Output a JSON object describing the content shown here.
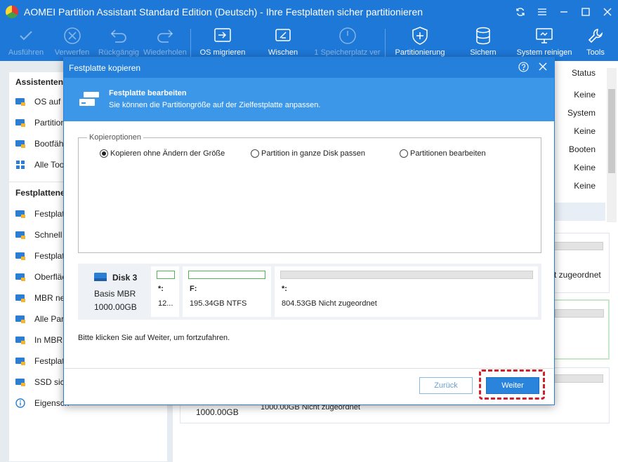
{
  "window": {
    "title": "AOMEI Partition Assistant Standard Edition (Deutsch) - Ihre Festplatten sicher partitionieren"
  },
  "toolbar": {
    "apply": "Ausführen",
    "discard": "Verwerfen",
    "undo": "Rückgängig",
    "redo": "Wiederholen",
    "migrate_os": "OS migrieren",
    "wipe": "Wischen",
    "free_space": "1 Speicherplatz ver",
    "partition": "Partitionierung",
    "backup": "Sichern",
    "clean": "System reinigen",
    "tools": "Tools"
  },
  "sidebar": {
    "wizards_heading": "Assistenten",
    "wizards": [
      {
        "label": "OS auf S",
        "icon": "os-migrate-icon"
      },
      {
        "label": "Partition",
        "icon": "partition-icon"
      },
      {
        "label": "Bootfähi",
        "icon": "bootable-icon"
      },
      {
        "label": "Alle Tool",
        "icon": "all-tools-icon"
      }
    ],
    "disk_heading": "Festplattene",
    "disk_ops": [
      {
        "label": "Festplatt",
        "icon": "disk-copy-icon"
      },
      {
        "label": "Schnell p",
        "icon": "quick-partition-icon"
      },
      {
        "label": "Festplatt",
        "icon": "disk-wipe-icon"
      },
      {
        "label": "Oberfläc",
        "icon": "surface-test-icon"
      },
      {
        "label": "MBR neu",
        "icon": "mbr-icon"
      },
      {
        "label": "Alle Part",
        "icon": "delete-all-icon"
      },
      {
        "label": "In MBR k",
        "icon": "convert-mbr-icon"
      },
      {
        "label": "Festplatt",
        "icon": "disk-properties-icon"
      },
      {
        "label": "SSD sich",
        "icon": "ssd-erase-icon"
      },
      {
        "label": "Eigensch",
        "icon": "info-icon"
      }
    ]
  },
  "table": {
    "status_header": "Status",
    "status_values": [
      "Keine",
      "System",
      "Keine",
      "Booten",
      "Keine",
      "Keine"
    ]
  },
  "background": {
    "disk_text_right": "t zugeordnet",
    "disk_size": "1000.00GB",
    "disk_part_text": "1000.00GB Nicht zugeordnet"
  },
  "dialog": {
    "title": "Festplatte kopieren",
    "header_title": "Festplatte bearbeiten",
    "header_subtitle": "Sie können die Partitiongröße auf der Zielfestplatte anpassen.",
    "options_legend": "Kopieroptionen",
    "options": [
      {
        "label": "Kopieren ohne Ändern der Größe",
        "selected": true
      },
      {
        "label": "Partition in ganze Disk passen",
        "selected": false
      },
      {
        "label": "Partitionen bearbeiten",
        "selected": false
      }
    ],
    "disk": {
      "name": "Disk 3",
      "type": "Basis MBR",
      "size": "1000.00GB",
      "partitions": [
        {
          "letter": "*:",
          "info": "12..."
        },
        {
          "letter": "F:",
          "info": "195.34GB NTFS"
        },
        {
          "letter": "*:",
          "info": "804.53GB Nicht zugeordnet"
        }
      ]
    },
    "hint": "Bitte klicken Sie auf Weiter, um fortzufahren.",
    "back_label": "Zurück",
    "next_label": "Weiter"
  },
  "colors": {
    "brand": "#1e78d7",
    "header": "#3d97e8",
    "highlight": "#d0202a",
    "partition_border": "#55b155"
  }
}
